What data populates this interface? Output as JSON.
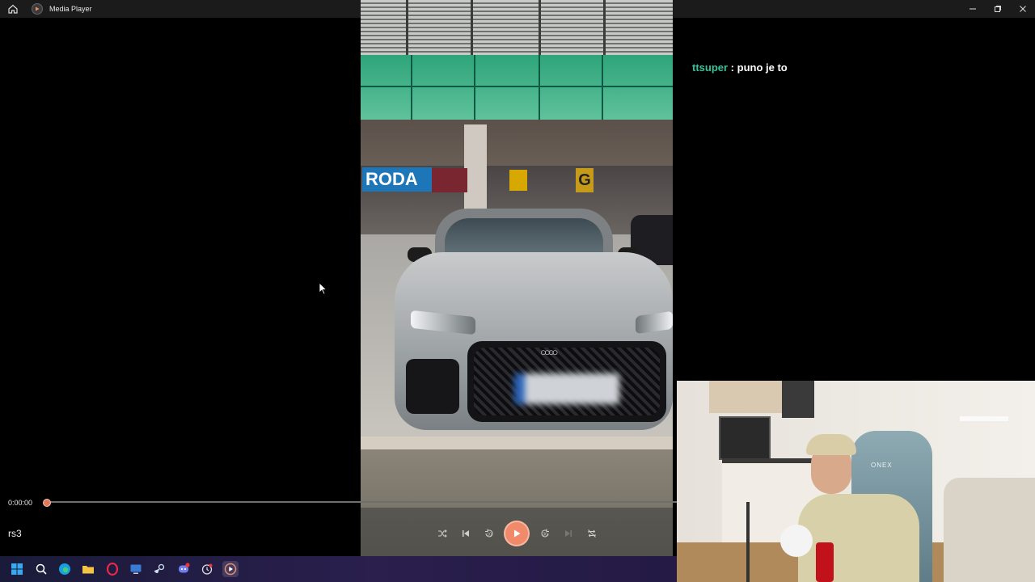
{
  "window": {
    "title": "Media Player",
    "controls": [
      "minimize",
      "maximize",
      "close"
    ]
  },
  "player": {
    "current_time": "0:00:00",
    "media_title": "rs3",
    "progress": 0.0,
    "controls": [
      "shuffle",
      "previous",
      "rewind-10",
      "play",
      "forward-30",
      "next",
      "repeat-off"
    ],
    "rewind_label": "10",
    "forward_label": "30"
  },
  "video": {
    "store_sign_1": "RODA",
    "store_sign_2": "G"
  },
  "chat": {
    "username": "ttsuper",
    "separator": " : ",
    "message": "puno je to",
    "username_color": "#34c49a"
  },
  "webcam": {
    "chair_brand": "ONEX"
  },
  "taskbar": {
    "icons": [
      "windows-start-icon",
      "search-icon",
      "edge-icon",
      "file-explorer-icon",
      "opera-icon",
      "monitor-app-icon",
      "steam-icon",
      "discord-icon",
      "clock-app-icon",
      "media-player-icon"
    ]
  },
  "colors": {
    "accent": "#f08a6a",
    "titlebar_bg": "#1b1b1b",
    "taskbar_bg": "#1a1b3a"
  }
}
